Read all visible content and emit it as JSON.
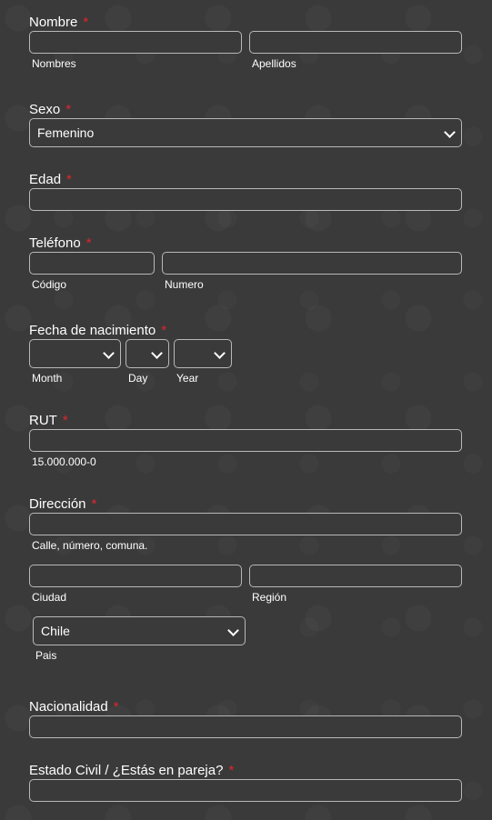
{
  "required_mark": "*",
  "nombre": {
    "label": "Nombre",
    "first_sub": "Nombres",
    "last_sub": "Apellidos",
    "first_value": "",
    "last_value": ""
  },
  "sexo": {
    "label": "Sexo",
    "selected": "Femenino"
  },
  "edad": {
    "label": "Edad",
    "value": ""
  },
  "telefono": {
    "label": "Teléfono",
    "code_sub": "Código",
    "number_sub": "Numero",
    "code_value": "",
    "number_value": ""
  },
  "fecha": {
    "label": "Fecha de nacimiento",
    "month_sub": "Month",
    "day_sub": "Day",
    "year_sub": "Year",
    "month_selected": "",
    "day_selected": "",
    "year_selected": ""
  },
  "rut": {
    "label": "RUT",
    "sub": "15.000.000-0",
    "value": ""
  },
  "direccion": {
    "label": "Dirección",
    "street_sub": "Calle, número, comuna.",
    "city_sub": "Ciudad",
    "region_sub": "Región",
    "country_selected": "Chile",
    "country_sub": "Pais",
    "street_value": "",
    "city_value": "",
    "region_value": ""
  },
  "nacionalidad": {
    "label": "Nacionalidad",
    "value": ""
  },
  "estado_civil": {
    "label": "Estado Civil / ¿Estás en pareja?",
    "value": ""
  },
  "colors": {
    "background": "#3a3a3a",
    "required": "#e0262c",
    "border": "#b8b8b8",
    "text": "#ffffff"
  }
}
